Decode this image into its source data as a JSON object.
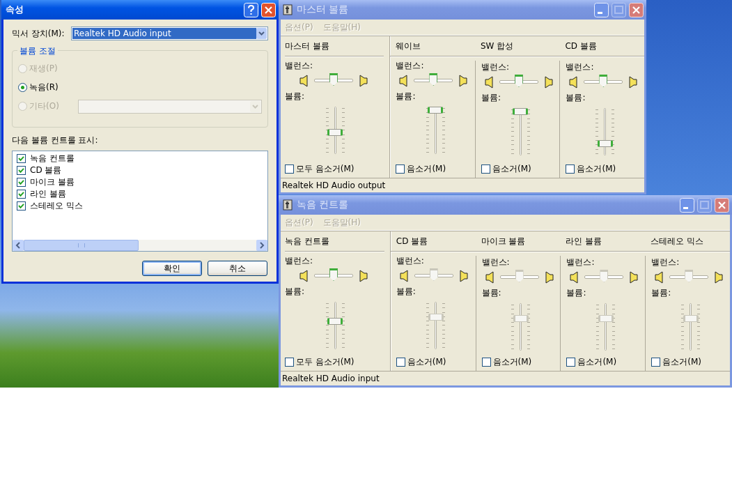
{
  "properties_dialog": {
    "title": "속성",
    "mixer_device_label": "믹서 장치(M):",
    "mixer_device_value": "Realtek HD Audio input",
    "group_title": "볼륨 조절",
    "radios": [
      {
        "label": "재생(P)",
        "selected": false,
        "disabled": true
      },
      {
        "label": "녹음(R)",
        "selected": true,
        "disabled": false
      },
      {
        "label": "기타(O)",
        "selected": false,
        "disabled": true
      }
    ],
    "list_label": "다음 볼륨 컨트롤 표시:",
    "controls": [
      {
        "label": "녹음 컨트롤",
        "checked": true
      },
      {
        "label": "CD 볼륨",
        "checked": true
      },
      {
        "label": "마이크 볼륨",
        "checked": true
      },
      {
        "label": "라인 볼륨",
        "checked": true
      },
      {
        "label": "스테레오 믹스",
        "checked": true
      }
    ],
    "buttons": [
      "확인",
      "취소"
    ]
  },
  "mixers": [
    {
      "title": "마스터 볼륨",
      "menu": [
        "옵션(P)",
        "도움말(H)"
      ],
      "status": "Realtek HD Audio output",
      "channels": [
        {
          "kind": "master",
          "name": "마스터 볼륨",
          "balance_label": "밸런스:",
          "volume_label": "볼륨:",
          "mute_label": "모두 음소거(M)",
          "muted": false,
          "disabled": false,
          "balance": {
            "level": 0.5
          },
          "volume": {
            "level": 0.45
          }
        },
        {
          "kind": "line",
          "name": "웨이브",
          "balance_label": "밸런스:",
          "volume_label": "볼륨:",
          "mute_label": "음소거(M)",
          "muted": false,
          "disabled": false,
          "balance": {
            "level": 0.5
          },
          "volume": {
            "level": 1
          }
        },
        {
          "kind": "line",
          "name": "SW 합성",
          "balance_label": "밸런스:",
          "volume_label": "볼륨:",
          "mute_label": "음소거(M)",
          "muted": false,
          "disabled": false,
          "balance": {
            "level": 0.5
          },
          "volume": {
            "level": 1
          }
        },
        {
          "kind": "line",
          "name": "CD 볼륨",
          "balance_label": "밸런스:",
          "volume_label": "볼륨:",
          "mute_label": "음소거(M)",
          "muted": false,
          "disabled": false,
          "balance": {
            "level": 0.5
          },
          "volume": {
            "level": 0.2
          }
        }
      ]
    },
    {
      "title": "녹음 컨트롤",
      "menu": [
        "옵션(P)",
        "도움말(H)"
      ],
      "status": "Realtek HD Audio input",
      "channels": [
        {
          "kind": "master",
          "name": "녹음 컨트롤",
          "balance_label": "밸런스:",
          "volume_label": "볼륨:",
          "mute_label": "모두 음소거(M)",
          "muted": false,
          "disabled": false,
          "balance": {
            "level": 0.5
          },
          "volume": {
            "level": 0.6
          }
        },
        {
          "kind": "line",
          "name": "CD 볼륨",
          "balance_label": "밸런스:",
          "volume_label": "볼륨:",
          "mute_label": "음소거(M)",
          "muted": false,
          "disabled": true,
          "balance": {
            "level": 0.5
          },
          "volume": {
            "level": 0.7
          }
        },
        {
          "kind": "line",
          "name": "마이크 볼륨",
          "balance_label": "밸런스:",
          "volume_label": "볼륨:",
          "mute_label": "음소거(M)",
          "muted": false,
          "disabled": true,
          "balance": {
            "level": 0.5
          },
          "volume": {
            "level": 0.7
          }
        },
        {
          "kind": "line",
          "name": "라인 볼륨",
          "balance_label": "밸런스:",
          "volume_label": "볼륨:",
          "mute_label": "음소거(M)",
          "muted": false,
          "disabled": true,
          "balance": {
            "level": 0.5
          },
          "volume": {
            "level": 0.7
          }
        },
        {
          "kind": "line",
          "name": "스테레오 믹스",
          "balance_label": "밸런스:",
          "volume_label": "볼륨:",
          "mute_label": "음소거(M)",
          "muted": false,
          "disabled": true,
          "balance": {
            "level": 0.5
          },
          "volume": {
            "level": 0.7
          }
        }
      ]
    }
  ]
}
